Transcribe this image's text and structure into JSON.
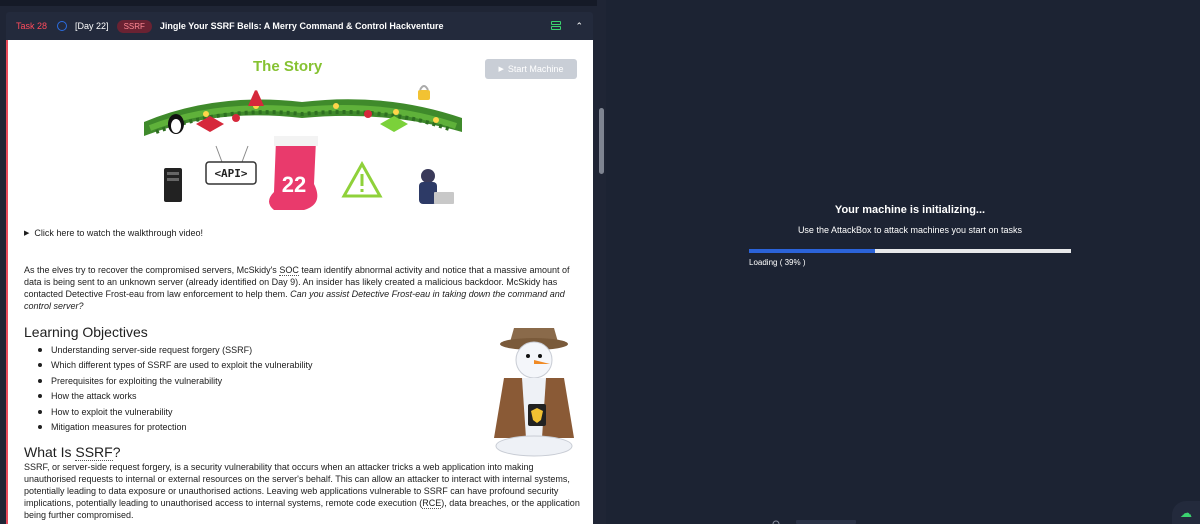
{
  "task": {
    "number": "Task 28",
    "day": "[Day 22]",
    "badge": "SSRF",
    "title": "Jingle Your SSRF Bells: A Merry Command & Control Hackventure"
  },
  "story": {
    "title": "The Story",
    "start_button": "Start Machine",
    "banner": {
      "api_label": "<API>",
      "stocking_number": "22"
    },
    "walkthrough": "Click here to watch the walkthrough video!",
    "intro_part1": "As the elves try to recover the compromised servers, McSkidy's ",
    "intro_soc": "SOC",
    "intro_part2": " team identify abnormal activity and notice that a massive amount of data is being sent to an unknown server (already identified on Day 9). An insider has likely created a malicious backdoor. McSkidy has contacted Detective Frost-eau from law enforcement to help them. ",
    "intro_italic": "Can you assist Detective Frost-eau in taking down the command and control server?"
  },
  "learning_objectives": {
    "heading": "Learning Objectives",
    "items": [
      "Understanding server-side request forgery (SSRF)",
      "Which different types of SSRF are used to exploit the vulnerability",
      "Prerequisites for exploiting the vulnerability",
      "How the attack works",
      "How to exploit the vulnerability",
      "Mitigation measures for protection"
    ]
  },
  "what_is_ssrf": {
    "heading_prefix": "What Is ",
    "heading_abbr": "SSRF",
    "heading_suffix": "?",
    "paragraph_part1": "SSRF, or server-side request forgery, is a security vulnerability that occurs when an attacker tricks a web application into making unauthorised requests to internal or external resources on the server's behalf. This can allow an attacker to interact with internal systems, potentially leading to data exposure or unauthorised actions. Leaving web applications vulnerable to SSRF can have profound security implications, potentially leading to unauthorised access to internal systems, remote code execution (",
    "paragraph_rce": "RCE",
    "paragraph_part2": "), data breaches, or the application being further compromised."
  },
  "machine": {
    "title": "Your machine is initializing...",
    "subtitle": "Use the AttackBox to attack machines you start on tasks",
    "loading_label": "Loading ( 39% )",
    "progress": 0.39
  },
  "colors": {
    "accent_red": "#e84a5a",
    "story_green": "#86c232",
    "progress_blue": "#2b63d9",
    "action_green": "#3bd36f"
  },
  "icons": {
    "task_status": "circle-icon",
    "expand": "stack-icon",
    "collapse": "chevron-up-icon",
    "play": "play-icon",
    "disclosure": "triangle-right-icon",
    "cloud": "cloud-upload-icon"
  }
}
